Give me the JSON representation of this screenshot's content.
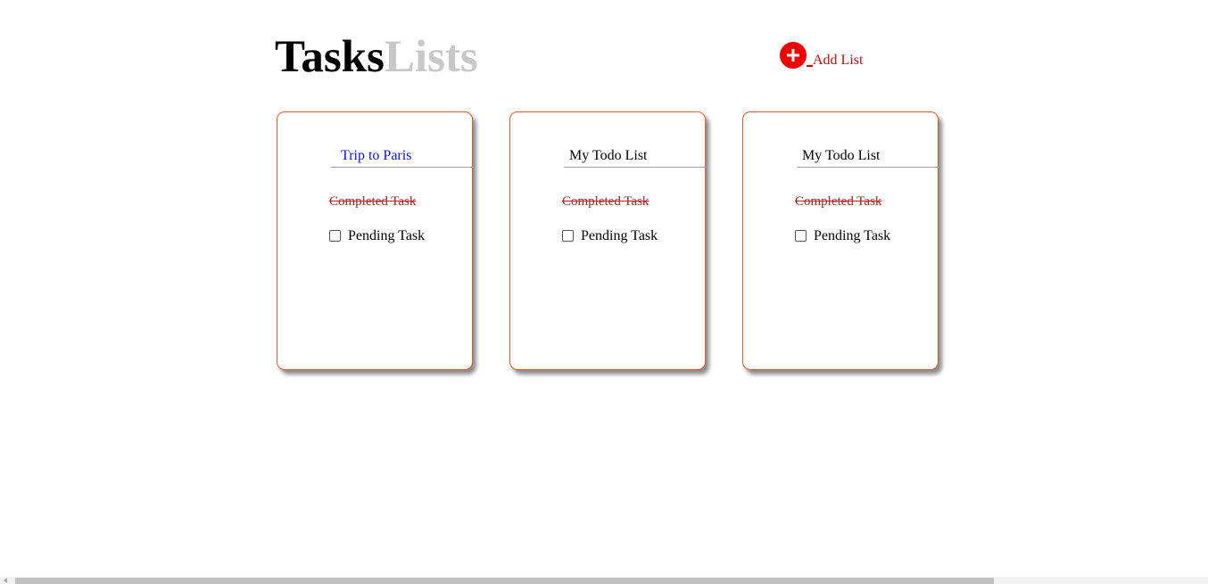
{
  "header": {
    "title_part1": "Tasks",
    "title_part2": "Lists",
    "add_list_label": "Add List",
    "add_icon": "plus-circle-icon",
    "accent_color": "#ee0000"
  },
  "lists": [
    {
      "title": "Trip to Paris",
      "completed_task": "Completed Task",
      "pending_task": "Pending Task",
      "pending_checked": false
    },
    {
      "title": "My Todo List",
      "completed_task": "Completed Task",
      "pending_task": "Pending Task",
      "pending_checked": false
    },
    {
      "title": "My Todo List",
      "completed_task": "Completed Task",
      "pending_task": "Pending Task",
      "pending_checked": false
    }
  ],
  "colors": {
    "card_border": "#e0582c",
    "completed_text": "#8a2a2a",
    "title_muted": "#c8c8c8",
    "first_list_title": "#1010cc"
  }
}
